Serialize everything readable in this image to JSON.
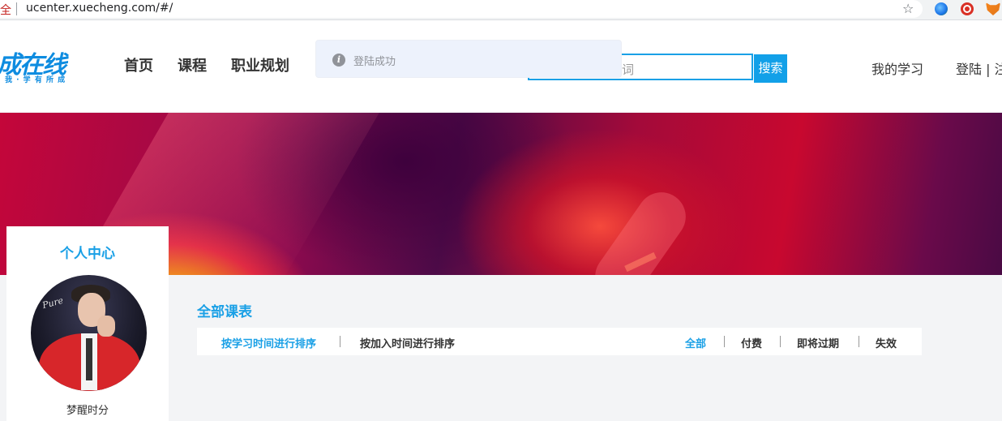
{
  "browser": {
    "security_label": "全",
    "url": "ucenter.xuecheng.com/#/"
  },
  "header": {
    "logo_text": "成在线",
    "logo_sub": "我 · 学 有 所 成",
    "nav": [
      "首页",
      "课程",
      "职业规划"
    ],
    "search": {
      "placeholder_visible": "词",
      "button": "搜索"
    },
    "my_study": "我的学习",
    "login": "登陆 | 注"
  },
  "toast": {
    "icon": "info-icon",
    "text": "登陆成功"
  },
  "profile": {
    "title": "个人中心",
    "avatar_text": "Pure",
    "name": "梦醒时分"
  },
  "main": {
    "section_title": "全部课表",
    "sort_options": [
      {
        "label": "按学习时间进行排序",
        "active": true
      },
      {
        "label": "按加入时间进行排序",
        "active": false
      }
    ],
    "filters": [
      {
        "label": "全部",
        "active": true
      },
      {
        "label": "付费",
        "active": false
      },
      {
        "label": "即将过期",
        "active": false
      },
      {
        "label": "失效",
        "active": false
      }
    ]
  },
  "colors": {
    "accent": "#1aa0e6",
    "toast_bg": "#edf2fc",
    "toast_text": "#909399"
  }
}
